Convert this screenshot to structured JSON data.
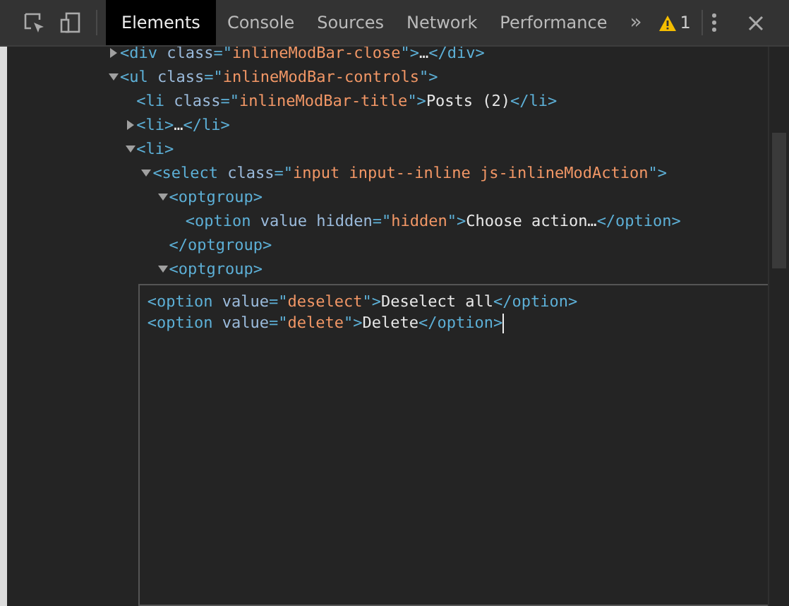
{
  "toolbar": {
    "tabs": [
      {
        "label": "Elements",
        "selected": true
      },
      {
        "label": "Console",
        "selected": false
      },
      {
        "label": "Sources",
        "selected": false
      },
      {
        "label": "Network",
        "selected": false
      },
      {
        "label": "Performance",
        "selected": false
      }
    ],
    "more": "»",
    "warnings": "1"
  },
  "tree": [
    {
      "expanded": false,
      "open": [
        {
          "kind": "tag",
          "text": "<div"
        },
        {
          "kind": "attr",
          "text": " class"
        },
        {
          "kind": "tag",
          "text": "=\""
        },
        {
          "kind": "value",
          "text": "inlineModBar-close"
        },
        {
          "kind": "tag",
          "text": "\">"
        },
        {
          "kind": "text",
          "text": "…"
        },
        {
          "kind": "tag",
          "text": "</div>"
        }
      ]
    },
    {
      "expanded": true,
      "open": [
        {
          "kind": "tag",
          "text": "<ul"
        },
        {
          "kind": "attr",
          "text": " class"
        },
        {
          "kind": "tag",
          "text": "=\""
        },
        {
          "kind": "value",
          "text": "inlineModBar-controls"
        },
        {
          "kind": "tag",
          "text": "\">"
        }
      ],
      "children": [
        {
          "open": [
            {
              "kind": "tag",
              "text": "<li"
            },
            {
              "kind": "attr",
              "text": " class"
            },
            {
              "kind": "tag",
              "text": "=\""
            },
            {
              "kind": "value",
              "text": "inlineModBar-title"
            },
            {
              "kind": "tag",
              "text": "\">"
            },
            {
              "kind": "text",
              "text": "Posts (2)"
            },
            {
              "kind": "tag",
              "text": "</li>"
            }
          ]
        },
        {
          "expanded": false,
          "open": [
            {
              "kind": "tag",
              "text": "<li>"
            },
            {
              "kind": "text",
              "text": "…"
            },
            {
              "kind": "tag",
              "text": "</li>"
            }
          ]
        },
        {
          "expanded": true,
          "open": [
            {
              "kind": "tag",
              "text": "<li>"
            }
          ],
          "children": [
            {
              "expanded": true,
              "open": [
                {
                  "kind": "tag",
                  "text": "<select"
                },
                {
                  "kind": "attr",
                  "text": " class"
                },
                {
                  "kind": "tag",
                  "text": "=\""
                },
                {
                  "kind": "value",
                  "text": "input input--inline js-inlineModAction"
                },
                {
                  "kind": "tag",
                  "text": "\">"
                }
              ],
              "children": [
                {
                  "expanded": true,
                  "open": [
                    {
                      "kind": "tag",
                      "text": "<optgroup>"
                    }
                  ],
                  "children": [
                    {
                      "open": [
                        {
                          "kind": "tag",
                          "text": "<option"
                        },
                        {
                          "kind": "attr",
                          "text": " value hidden"
                        },
                        {
                          "kind": "tag",
                          "text": "=\""
                        },
                        {
                          "kind": "value",
                          "text": "hidden"
                        },
                        {
                          "kind": "tag",
                          "text": "\">"
                        },
                        {
                          "kind": "text",
                          "text": "Choose action…"
                        },
                        {
                          "kind": "tag",
                          "text": "</option>"
                        }
                      ]
                    }
                  ],
                  "close": [
                    {
                      "kind": "tag",
                      "text": "</optgroup>"
                    }
                  ]
                },
                {
                  "expanded": true,
                  "open": [
                    {
                      "kind": "tag",
                      "text": "<optgroup>"
                    }
                  ],
                  "editor": [
                    [
                      {
                        "kind": "tag",
                        "text": "<option"
                      },
                      {
                        "kind": "attr",
                        "text": " value"
                      },
                      {
                        "kind": "tag",
                        "text": "=\""
                      },
                      {
                        "kind": "value",
                        "text": "deselect"
                      },
                      {
                        "kind": "tag",
                        "text": "\">"
                      },
                      {
                        "kind": "text",
                        "text": "Deselect all"
                      },
                      {
                        "kind": "tag",
                        "text": "</option>"
                      }
                    ],
                    [
                      {
                        "kind": "tag",
                        "text": "<option"
                      },
                      {
                        "kind": "attr",
                        "text": " value"
                      },
                      {
                        "kind": "tag",
                        "text": "=\""
                      },
                      {
                        "kind": "value",
                        "text": "delete"
                      },
                      {
                        "kind": "tag",
                        "text": "\">"
                      },
                      {
                        "kind": "text",
                        "text": "Delete"
                      },
                      {
                        "kind": "tag",
                        "text": "</option>"
                      }
                    ]
                  ]
                }
              ]
            }
          ]
        }
      ]
    }
  ]
}
